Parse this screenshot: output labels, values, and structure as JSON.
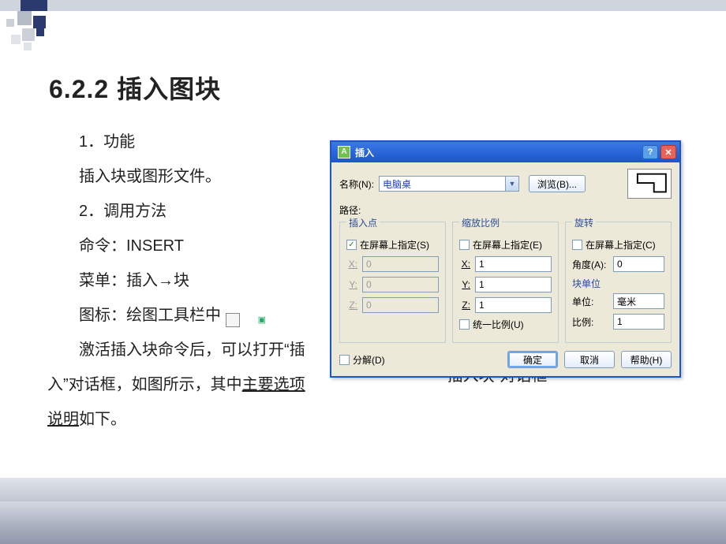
{
  "heading": "6.2.2 插入图块",
  "body": {
    "p1": "1．功能",
    "p2": "插入块或图形文件。",
    "p3": "2．调用方法",
    "p4": "命令：INSERT",
    "p5": "菜单：插入→块",
    "p6_pre": "图标：绘图工具栏中",
    "p7": "激活插入块命令后，可以打开“插入”对话框，如图所示，其中",
    "p7_link": "主要选项说明",
    "p7_tail": "如下。"
  },
  "caption": "“插入块”对话框",
  "dialog": {
    "title": "插入",
    "name_label": "名称(N):",
    "name_value": "电脑桌",
    "browse": "浏览(B)...",
    "path_label": "路径:",
    "groups": {
      "insert": {
        "title": "插入点",
        "specify": "在屏幕上指定(S)",
        "checked": true,
        "x": "0",
        "y": "0",
        "z": "0"
      },
      "scale": {
        "title": "缩放比例",
        "specify": "在屏幕上指定(E)",
        "checked": false,
        "x": "1",
        "y": "1",
        "z": "1",
        "uniform": "统一比例(U)"
      },
      "rotate": {
        "title": "旋转",
        "specify": "在屏幕上指定(C)",
        "checked": false,
        "angle_label": "角度(A):",
        "angle": "0",
        "unit_title": "块单位",
        "unit_label": "单位:",
        "unit": "毫米",
        "ratio_label": "比例:",
        "ratio": "1"
      }
    },
    "explode": "分解(D)",
    "ok": "确定",
    "cancel": "取消",
    "help": "帮助(H)"
  }
}
